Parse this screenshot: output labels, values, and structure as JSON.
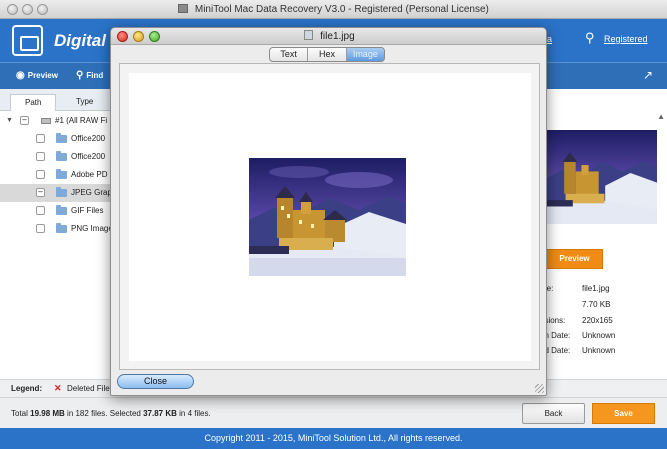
{
  "window": {
    "title": "MiniTool Mac Data Recovery V3.0 - Registered (Personal License)"
  },
  "header": {
    "app_name": "Digital P",
    "link_media": "dia",
    "link_registered": "Registered"
  },
  "toolbar": {
    "preview_label": "Preview",
    "find_label": "Find"
  },
  "left_panel": {
    "tabs": [
      {
        "label": "Path"
      },
      {
        "label": "Type"
      }
    ],
    "root_label": "#1 (All RAW Fi",
    "items": [
      {
        "label": "Office200"
      },
      {
        "label": "Office200"
      },
      {
        "label": "Adobe PD"
      },
      {
        "label": "JPEG Grap"
      },
      {
        "label": "GIF Files"
      },
      {
        "label": "PNG Image"
      }
    ]
  },
  "right_panel": {
    "preview_button": "Preview",
    "info": [
      {
        "key": "me:",
        "value": "file1.jpg"
      },
      {
        "key": "",
        "value": "7.70 KB"
      },
      {
        "key": "nsions:",
        "value": "220x165"
      },
      {
        "key": "on Date:",
        "value": "Unknown"
      },
      {
        "key": "ed Date:",
        "value": "Unknown"
      }
    ]
  },
  "legend": {
    "label": "Legend:",
    "deleted_label": "Deleted File"
  },
  "status": {
    "prefix": "Total ",
    "total_size": "19.98 MB",
    "in1": " in ",
    "total_files": "182",
    "files_selected": " files.  Selected ",
    "selected_size": "37.87 KB",
    "in2": " in ",
    "selected_files": "4",
    "suffix": " files."
  },
  "buttons": {
    "back": "Back",
    "save": "Save"
  },
  "footer": {
    "copyright": "Copyright 2011 - 2015, MiniTool Solution Ltd., All rights reserved."
  },
  "dialog": {
    "title": "file1.jpg",
    "tabs": [
      {
        "label": "Text"
      },
      {
        "label": "Hex"
      },
      {
        "label": "Image"
      }
    ],
    "active_tab": "Image",
    "close_label": "Close"
  },
  "colors": {
    "header_blue": "#2b73c9",
    "accent_orange": "#f5961e",
    "deleted_red": "#d52020"
  }
}
